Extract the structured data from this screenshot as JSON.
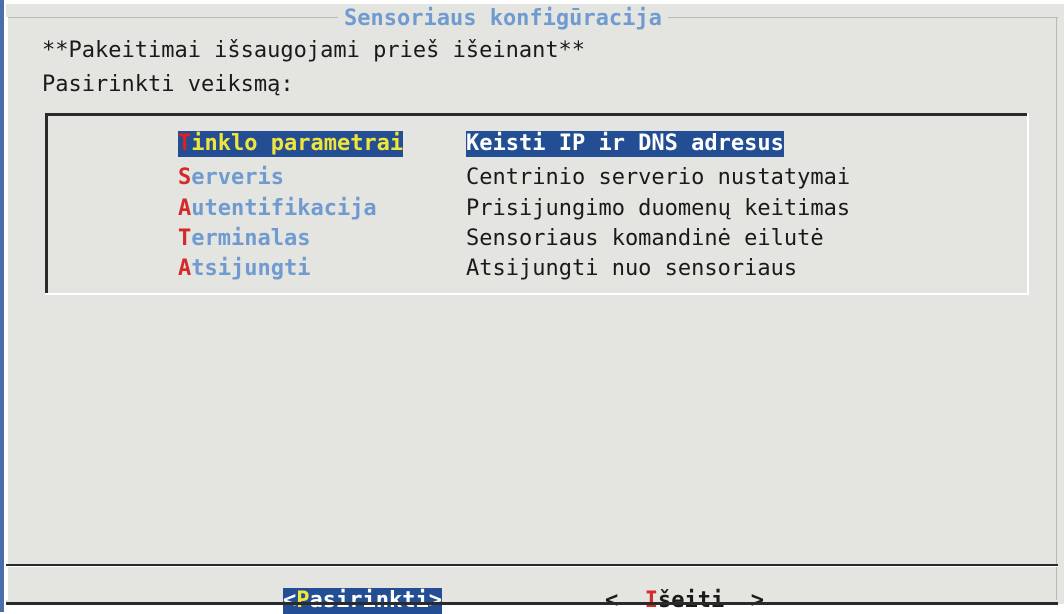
{
  "dialog": {
    "title": "Sensoriaus konfigūracija",
    "line1": "**Pakeitimai išsaugojami prieš išeinant**",
    "line2": "Pasirinkti veiksmą:"
  },
  "menu": {
    "items": [
      {
        "hotkey": "T",
        "rest": "inklo parametrai",
        "description": "Keisti IP ir DNS adresus",
        "selected": true
      },
      {
        "hotkey": "S",
        "rest": "erveris",
        "description": "Centrinio serverio nustatymai",
        "selected": false
      },
      {
        "hotkey": "A",
        "rest": "utentifikacija",
        "description": "Prisijungimo duomenų keitimas",
        "selected": false
      },
      {
        "hotkey": "T",
        "rest": "erminalas",
        "description": "Sensoriaus komandinė eilutė",
        "selected": false
      },
      {
        "hotkey": "A",
        "rest": "tsijungti",
        "description": "Atsijungti nuo sensoriaus",
        "selected": false
      }
    ]
  },
  "buttons": {
    "ok": {
      "open": "<",
      "hotkey": "P",
      "rest": "asirinkti",
      "close": ">"
    },
    "exit": {
      "open": "<  ",
      "hotkey": "I",
      "rest": "šeiti",
      "close": "  >"
    }
  },
  "colors": {
    "background": "#e4e4e0",
    "title": "#6f9bd1",
    "selection": "#234e93",
    "selected_tag_text": "#f2e53a",
    "hotkey": "#d42a2a"
  }
}
